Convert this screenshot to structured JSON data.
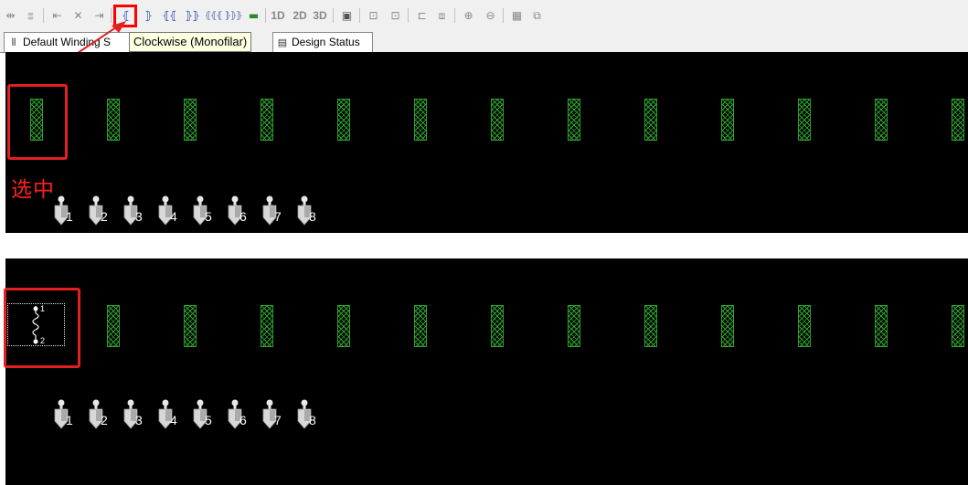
{
  "toolbar": {
    "tooltip": "Clockwise (Monofilar)",
    "buttons": [
      {
        "name": "align-icon-1",
        "glyph": "⇹"
      },
      {
        "name": "align-icon-2",
        "glyph": "⦂"
      },
      {
        "name": "move-left-icon",
        "glyph": "⇤"
      },
      {
        "name": "cross-icon",
        "glyph": "✕"
      },
      {
        "name": "move-right-icon",
        "glyph": "⇥"
      },
      {
        "name": "clockwise-monofilar-icon",
        "glyph": "⦃"
      },
      {
        "name": "counterclockwise-monofilar-icon",
        "glyph": "⦄"
      },
      {
        "name": "clockwise-bifilar-icon",
        "glyph": "⦃⦃"
      },
      {
        "name": "counterclockwise-bifilar-icon",
        "glyph": "⦄⦄"
      },
      {
        "name": "clockwise-multifilar-icon",
        "glyph": "⦃⦃⦃"
      },
      {
        "name": "counterclockwise-multifilar-icon",
        "glyph": "⦄⦄⦄"
      },
      {
        "name": "foil-icon",
        "glyph": "▬"
      },
      {
        "name": "settings-icon",
        "glyph": "▣"
      },
      {
        "name": "export-icon-1",
        "glyph": "⊡"
      },
      {
        "name": "export-icon-2",
        "glyph": "⊡"
      },
      {
        "name": "layer-icon-1",
        "glyph": "⊏"
      },
      {
        "name": "layer-icon-2",
        "glyph": "⧈"
      },
      {
        "name": "zoom-in-icon",
        "glyph": "⊕"
      },
      {
        "name": "zoom-out-icon",
        "glyph": "⊖"
      },
      {
        "name": "table-icon",
        "glyph": "▦"
      },
      {
        "name": "window-icon",
        "glyph": "⧉"
      }
    ],
    "view_1d": "1D",
    "view_2d": "2D",
    "view_3d": "3D"
  },
  "tabs": {
    "winding": "Default Winding S",
    "design_status": "Design Status"
  },
  "annotation": {
    "selected_label": "选中",
    "accent_color": "#e32020"
  },
  "coil_color": "#2ea32e",
  "pins": [
    "1",
    "2",
    "3",
    "4",
    "5",
    "6",
    "7",
    "8"
  ],
  "winding_labels": {
    "start": "1",
    "end": "2"
  }
}
